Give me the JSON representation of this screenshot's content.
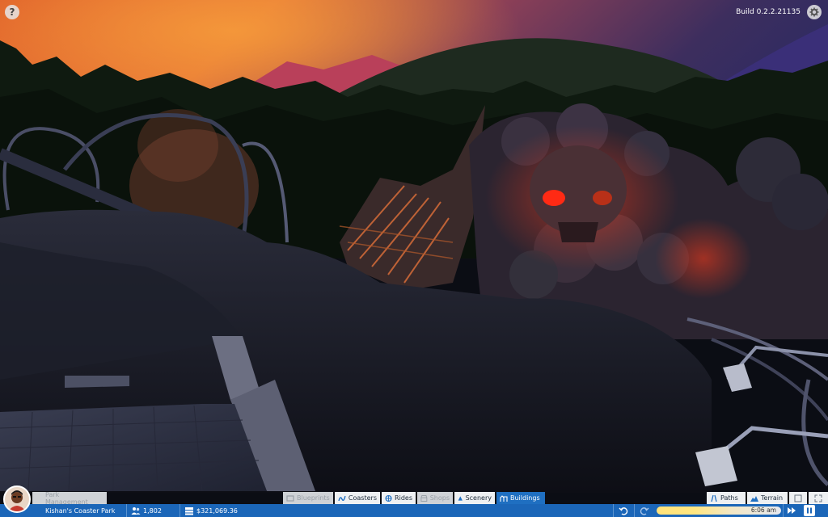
{
  "hud": {
    "help_label": "?",
    "build_label": "Build 0.2.2.21135"
  },
  "toolbar": {
    "park_management": "Park Management",
    "blueprints": "Blueprints",
    "coasters": "Coasters",
    "rides": "Rides",
    "shops": "Shops",
    "scenery": "Scenery",
    "buildings": "Buildings",
    "paths": "Paths",
    "terrain": "Terrain"
  },
  "status": {
    "park_name": "Kishan's Coaster Park",
    "guests": "1,802",
    "money": "$321,069.36",
    "time": "6:06 am"
  },
  "colors": {
    "accent": "#1b66b8",
    "active_tab": "#1f6fc1"
  },
  "icons": [
    "help-icon",
    "settings-gear-icon",
    "guests-icon",
    "money-icon",
    "undo-icon",
    "redo-icon",
    "fast-forward-icon",
    "pause-icon",
    "blueprints-icon",
    "coasters-icon",
    "rides-icon",
    "shops-icon",
    "scenery-icon",
    "buildings-icon",
    "paths-icon",
    "terrain-icon",
    "grid-icon",
    "expand-icon"
  ]
}
